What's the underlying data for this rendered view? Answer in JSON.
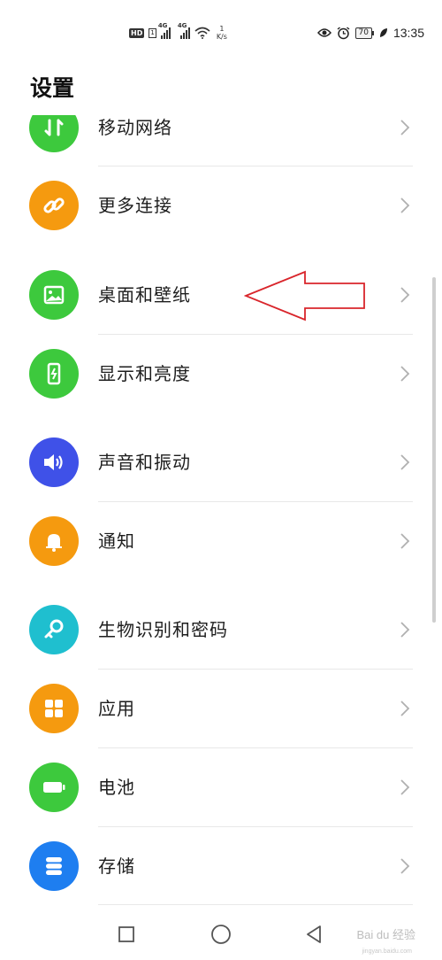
{
  "status_bar": {
    "hd": "HD",
    "sim": "1",
    "signal1_tag": "4G",
    "signal2_tag": "4G",
    "speed_value": "1",
    "speed_unit": "K/s",
    "battery": "70",
    "time": "13:35",
    "icons": [
      "eye-icon",
      "alarm-icon",
      "battery-icon",
      "leaf-icon"
    ]
  },
  "page": {
    "title": "设置"
  },
  "settings": [
    {
      "label": "移动网络",
      "icon": "mobile-network-icon",
      "color": "#3dc93d"
    },
    {
      "label": "更多连接",
      "icon": "link-icon",
      "color": "#f59a0f"
    },
    {
      "label": "桌面和壁纸",
      "icon": "image-icon",
      "color": "#3dc93d"
    },
    {
      "label": "显示和亮度",
      "icon": "phone-brightness-icon",
      "color": "#3dc93d"
    },
    {
      "label": "声音和振动",
      "icon": "speaker-icon",
      "color": "#3f51e8"
    },
    {
      "label": "通知",
      "icon": "bell-icon",
      "color": "#f59a0f"
    },
    {
      "label": "生物识别和密码",
      "icon": "key-icon",
      "color": "#1fbfcf"
    },
    {
      "label": "应用",
      "icon": "apps-grid-icon",
      "color": "#f59a0f"
    },
    {
      "label": "电池",
      "icon": "battery-icon",
      "color": "#3dc93d"
    },
    {
      "label": "存储",
      "icon": "storage-icon",
      "color": "#1e7ef0"
    }
  ],
  "annotation": {
    "color": "#d9252b"
  },
  "watermark": {
    "text": "Bai du 经验",
    "sub": "jingyan.baidu.com"
  },
  "nav": {
    "icons": [
      "square-recent-icon",
      "circle-home-icon",
      "triangle-back-icon"
    ]
  }
}
